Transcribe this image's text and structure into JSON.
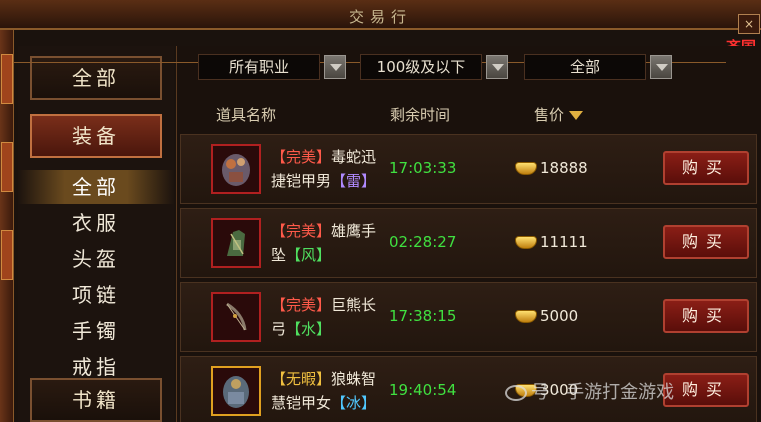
{
  "window": {
    "title": "交易行",
    "close_label": "×",
    "side_flag": "齐国"
  },
  "sidebar": {
    "categories": [
      {
        "label": "全部"
      },
      {
        "label": "装备"
      },
      {
        "label": "书籍"
      }
    ],
    "sub_items": [
      {
        "label": "全部"
      },
      {
        "label": "衣服"
      },
      {
        "label": "头盔"
      },
      {
        "label": "项链"
      },
      {
        "label": "手镯"
      },
      {
        "label": "戒指"
      }
    ]
  },
  "filters": {
    "profession": "所有职业",
    "level": "100级及以下",
    "type": "全部"
  },
  "columns": {
    "name": "道具名称",
    "time": "剩余时间",
    "price": "售价"
  },
  "listings": [
    {
      "quality": "【完美】",
      "name": "毒蛇迅捷铠甲男",
      "element": "【雷】",
      "time": "17:03:33",
      "price": "18888",
      "buy": "购买"
    },
    {
      "quality": "【完美】",
      "name": "雄鹰手坠",
      "element": "【风】",
      "time": "02:28:27",
      "price": "11111",
      "buy": "购买"
    },
    {
      "quality": "【完美】",
      "name": "巨熊长弓",
      "element": "【水】",
      "time": "17:38:15",
      "price": "5000",
      "buy": "购买"
    },
    {
      "quality": "【无暇】",
      "name": "狼蛛智慧铠甲女",
      "element": "【冰】",
      "time": "19:40:54",
      "price": "3000",
      "buy": "购买"
    }
  ],
  "watermark": "号 · 手游打金游戏",
  "colors": {
    "quality_perfect": "#ff5a4a",
    "quality_flawless": "#f0c040",
    "time": "#40e040"
  },
  "icons": [
    "armor-icon",
    "glove-icon",
    "bow-icon",
    "armor-icon",
    "gold-ingot-icon"
  ]
}
